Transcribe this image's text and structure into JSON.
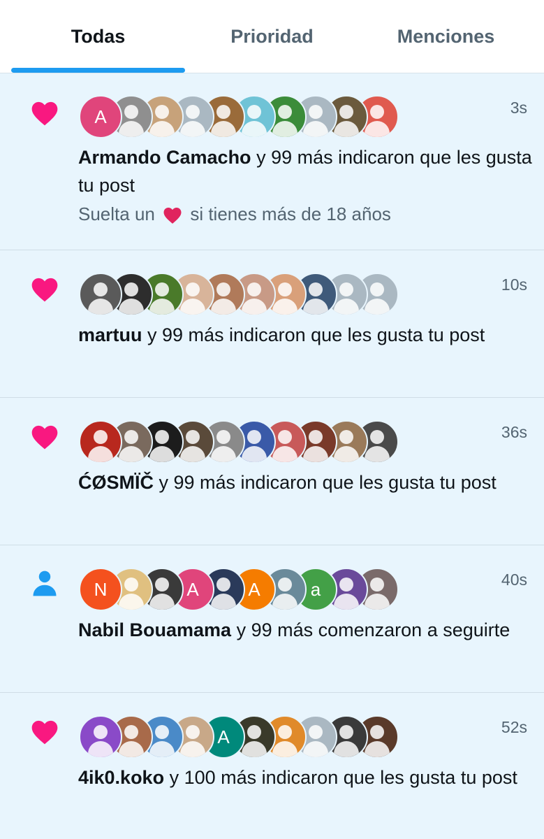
{
  "tabs": [
    {
      "label": "Todas",
      "active": true
    },
    {
      "label": "Prioridad",
      "active": false
    },
    {
      "label": "Menciones",
      "active": false
    }
  ],
  "colors": {
    "accent": "#1d9bf0",
    "heart": "#f91880",
    "background": "#e8f5fd"
  },
  "notifications": [
    {
      "type": "like",
      "icon": "heart-icon",
      "time": "3s",
      "name": "Armando Camacho",
      "text": " y 99 más indicaron que les gusta tu post",
      "sub_before": "Suelta un ",
      "sub_after": " si tienes más de 18 años",
      "avatars": [
        {
          "letter": "A",
          "color": "#e0457b"
        },
        {
          "letter": "",
          "color": "#8f8f8f"
        },
        {
          "letter": "",
          "color": "#c7a27a"
        },
        {
          "letter": "",
          "color": "#aab8c2"
        },
        {
          "letter": "",
          "color": "#9a6b3a"
        },
        {
          "letter": "",
          "color": "#6fc3d6"
        },
        {
          "letter": "",
          "color": "#3b8c3a"
        },
        {
          "letter": "",
          "color": "#aab8c2"
        },
        {
          "letter": "",
          "color": "#6b5a3d"
        },
        {
          "letter": "",
          "color": "#e05a4f"
        }
      ]
    },
    {
      "type": "like",
      "icon": "heart-icon",
      "time": "10s",
      "name": "martuu",
      "text": " y 99 más indicaron que les gusta tu post",
      "avatars": [
        {
          "letter": "",
          "color": "#5a5a5a"
        },
        {
          "letter": "",
          "color": "#2d2d2d"
        },
        {
          "letter": "",
          "color": "#4a7a2a"
        },
        {
          "letter": "",
          "color": "#d8b49a"
        },
        {
          "letter": "",
          "color": "#b07a5a"
        },
        {
          "letter": "",
          "color": "#c89a86"
        },
        {
          "letter": "",
          "color": "#d9a07a"
        },
        {
          "letter": "",
          "color": "#3f5a7a"
        },
        {
          "letter": "",
          "color": "#aab8c2"
        },
        {
          "letter": "",
          "color": "#aab8c2"
        }
      ]
    },
    {
      "type": "like",
      "icon": "heart-icon",
      "time": "36s",
      "name": "ĆØSMÏČ",
      "text": " y 99 más indicaron que les gusta tu post",
      "avatars": [
        {
          "letter": "",
          "color": "#b8281e"
        },
        {
          "letter": "",
          "color": "#7a6a5e"
        },
        {
          "letter": "",
          "color": "#1c1c1c"
        },
        {
          "letter": "",
          "color": "#5a4a3a"
        },
        {
          "letter": "",
          "color": "#8a8a8a"
        },
        {
          "letter": "",
          "color": "#3a5aa8"
        },
        {
          "letter": "",
          "color": "#c85a5a"
        },
        {
          "letter": "",
          "color": "#7a3a2a"
        },
        {
          "letter": "",
          "color": "#9a7a5a"
        },
        {
          "letter": "",
          "color": "#4a4a4a"
        }
      ]
    },
    {
      "type": "follow",
      "icon": "person-icon",
      "time": "40s",
      "name": "Nabil Bouamama",
      "text": " y 99 más comenzaron a seguirte",
      "avatars": [
        {
          "letter": "N",
          "color": "#f4511e"
        },
        {
          "letter": "",
          "color": "#e0c080"
        },
        {
          "letter": "",
          "color": "#3a3a3a"
        },
        {
          "letter": "A",
          "color": "#e0457b"
        },
        {
          "letter": "",
          "color": "#2a3a5a"
        },
        {
          "letter": "A",
          "color": "#f57c00"
        },
        {
          "letter": "",
          "color": "#6a8a9a"
        },
        {
          "letter": "a",
          "color": "#43a047"
        },
        {
          "letter": "",
          "color": "#6a4a9a"
        },
        {
          "letter": "",
          "color": "#7a6a6a"
        }
      ]
    },
    {
      "type": "like",
      "icon": "heart-icon",
      "time": "52s",
      "name": "4ik0.koko",
      "text": " y 100 más indicaron que les gusta tu post",
      "avatars": [
        {
          "letter": "",
          "color": "#8a4ac8"
        },
        {
          "letter": "",
          "color": "#a86a4a"
        },
        {
          "letter": "",
          "color": "#4a8ac8"
        },
        {
          "letter": "",
          "color": "#c8a888"
        },
        {
          "letter": "A",
          "color": "#00897b"
        },
        {
          "letter": "",
          "color": "#3a3a2a"
        },
        {
          "letter": "",
          "color": "#e08a2a"
        },
        {
          "letter": "",
          "color": "#aab8c2"
        },
        {
          "letter": "",
          "color": "#3a3a3a"
        },
        {
          "letter": "",
          "color": "#5a3a2a"
        }
      ]
    }
  ]
}
